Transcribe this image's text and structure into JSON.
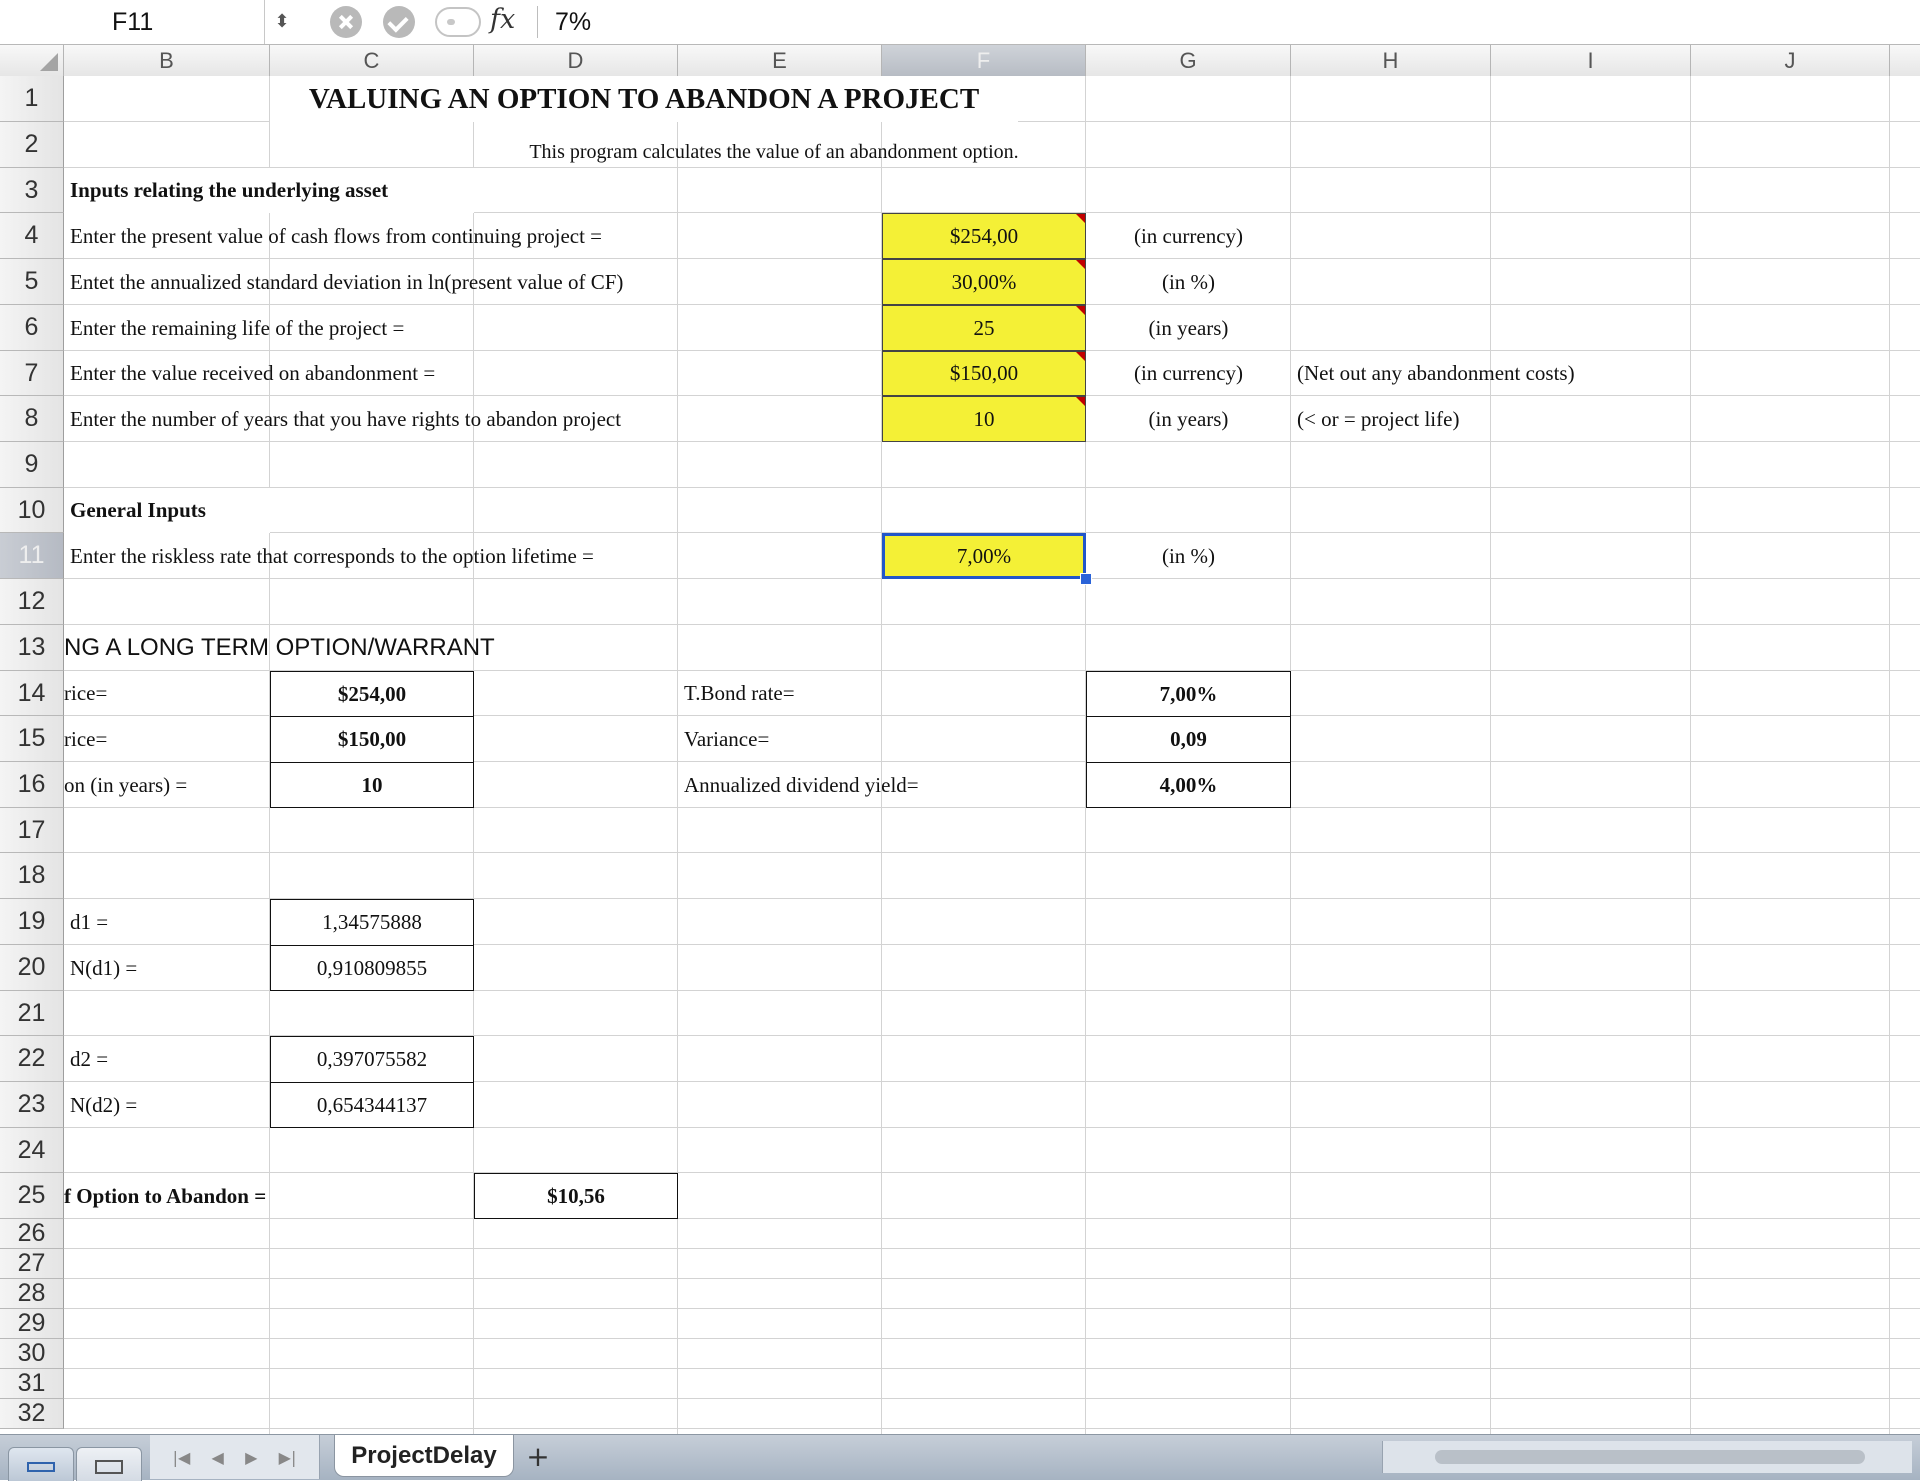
{
  "formula_bar": {
    "name_box": "F11",
    "fx_label": "fx",
    "formula_value": "7%"
  },
  "columns": [
    "B",
    "C",
    "D",
    "E",
    "F",
    "G",
    "H",
    "I",
    "J"
  ],
  "rows": {
    "r1": "1",
    "r2": "2",
    "r3": "3",
    "r4": "4",
    "r5": "5",
    "r6": "6",
    "r7": "7",
    "r8": "8",
    "r9": "9",
    "r10": "10",
    "r11": "11",
    "r12": "12",
    "r13": "13",
    "r14": "14",
    "r15": "15",
    "r16": "16",
    "r17": "17",
    "r18": "18",
    "r19": "19",
    "r20": "20",
    "r21": "21",
    "r22": "22",
    "r23": "23",
    "r24": "24",
    "r25": "25",
    "r26": "26",
    "r27": "27",
    "r28": "28",
    "r29": "29",
    "r30": "30",
    "r31": "31",
    "r32": "32"
  },
  "sheet": {
    "title": "VALUING AN OPTION TO ABANDON A PROJECT",
    "subtitle": "This program calculates the value of an abandonment option.",
    "inputs_header": "Inputs relating the underlying asset",
    "input_labels": {
      "pv_cash_flows": "Enter the present value of cash flows from continuing project =",
      "std_dev": "Entet the annualized standard deviation in ln(present value of CF)",
      "remaining_life": "Enter the remaining life of the project =",
      "abandon_value": "Enter the value received on abandonment =",
      "abandon_years": "Enter the number of years that you have rights to abandon project"
    },
    "input_values": {
      "pv_cash_flows": "$254,00",
      "std_dev": "30,00%",
      "remaining_life": "25",
      "abandon_value": "$150,00",
      "abandon_years": "10"
    },
    "input_units": {
      "pv_cash_flows": "(in currency)",
      "std_dev": "(in %)",
      "remaining_life": "(in years)",
      "abandon_value": "(in currency)",
      "abandon_years": "(in years)"
    },
    "input_notes": {
      "abandon_value": "(Net out any abandonment costs)",
      "abandon_years": "(< or = project life)"
    },
    "general_header": "General Inputs",
    "riskless_label": "Enter the riskless rate that corresponds to the option lifetime =",
    "riskless_value": "7,00%",
    "riskless_unit": "(in %)",
    "section_header": "NG A LONG TERM OPTION/WARRANT",
    "price_label": "rice=",
    "price_value": "$254,00",
    "strike_label": "rice=",
    "strike_value": "$150,00",
    "expiration_label": "on (in years) =",
    "expiration_value": "10",
    "tbond_label": "T.Bond rate=",
    "tbond_value": "7,00%",
    "variance_label": "Variance=",
    "variance_value": "0,09",
    "dividend_label": "Annualized dividend yield=",
    "dividend_value": "4,00%",
    "d1_label": "d1 =",
    "d1_value": "1,34575888",
    "nd1_label": "N(d1) =",
    "nd1_value": "0,910809855",
    "d2_label": "d2 =",
    "d2_value": "0,397075582",
    "nd2_label": "N(d2) =",
    "nd2_value": "0,654344137",
    "option_label": "f Option to Abandon =",
    "option_value": "$10,56"
  },
  "tabs": {
    "nav_first": "|◀",
    "nav_prev": "◀",
    "nav_next": "▶",
    "nav_last": "▶|",
    "sheet_name": "ProjectDelay",
    "add": "+"
  },
  "colors": {
    "input_fill": "#f4f036",
    "selection": "#2256c9",
    "comment_marker": "#c00000"
  }
}
